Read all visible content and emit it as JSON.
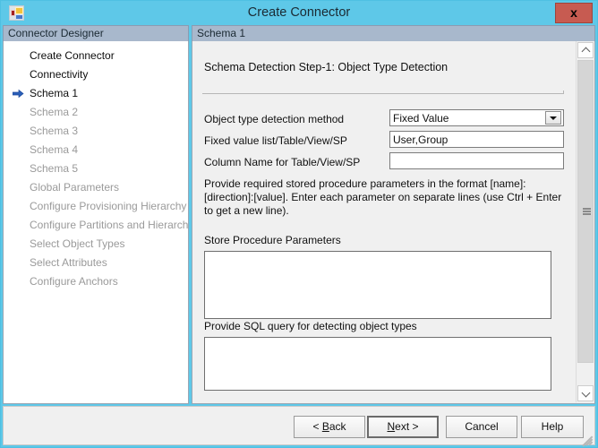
{
  "window": {
    "title": "Create Connector",
    "app_icon": "connector-tiles-icon",
    "close_label": "x"
  },
  "sidebar": {
    "header": "Connector Designer",
    "items": [
      {
        "label": "Create Connector",
        "state": "enabled",
        "active": false
      },
      {
        "label": "Connectivity",
        "state": "enabled",
        "active": false
      },
      {
        "label": "Schema 1",
        "state": "enabled",
        "active": true
      },
      {
        "label": "Schema 2",
        "state": "disabled",
        "active": false
      },
      {
        "label": "Schema 3",
        "state": "disabled",
        "active": false
      },
      {
        "label": "Schema 4",
        "state": "disabled",
        "active": false
      },
      {
        "label": "Schema 5",
        "state": "disabled",
        "active": false
      },
      {
        "label": "Global Parameters",
        "state": "disabled",
        "active": false
      },
      {
        "label": "Configure Provisioning Hierarchy",
        "state": "disabled",
        "active": false
      },
      {
        "label": "Configure Partitions and Hierarchies",
        "state": "disabled",
        "active": false
      },
      {
        "label": "Select Object Types",
        "state": "disabled",
        "active": false
      },
      {
        "label": "Select Attributes",
        "state": "disabled",
        "active": false
      },
      {
        "label": "Configure Anchors",
        "state": "disabled",
        "active": false
      }
    ]
  },
  "content": {
    "header": "Schema 1",
    "step_title": "Schema Detection Step-1: Object Type Detection",
    "fields": {
      "detection_method_label": "Object type detection method",
      "detection_method_value": "Fixed Value",
      "detection_method_options": [
        "Fixed Value"
      ],
      "fixed_value_list_label": "Fixed value list/Table/View/SP",
      "fixed_value_list_value": "User,Group",
      "column_name_label": "Column Name for Table/View/SP",
      "column_name_value": ""
    },
    "helper_text": "Provide required stored procedure parameters in the format [name]:[direction]:[value]. Enter each parameter on separate lines (use Ctrl + Enter to get a new line).",
    "store_procedure_label": "Store Procedure Parameters",
    "store_procedure_value": "",
    "sql_query_label": "Provide SQL query for detecting object types",
    "sql_query_value": "",
    "scrollbar": {
      "up_icon": "chevron-up-icon",
      "down_icon": "chevron-down-icon"
    }
  },
  "footer": {
    "back": {
      "prefix": "< ",
      "accel": "B",
      "suffix": "ack"
    },
    "next": {
      "prefix": "",
      "accel": "N",
      "suffix": "ext >"
    },
    "cancel": "Cancel",
    "help": "Help"
  }
}
